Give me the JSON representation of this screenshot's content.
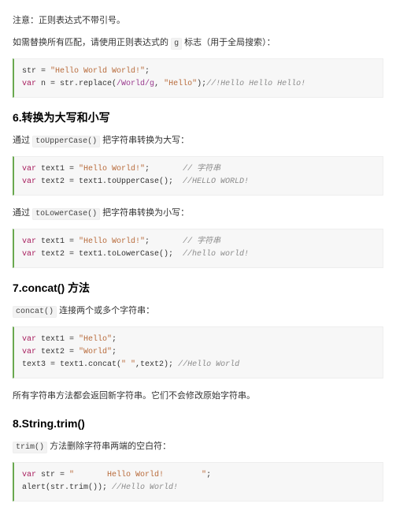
{
  "p1": "注意：正则表达式不带引号。",
  "p2_a": "如需替换所有匹配，请使用正则表达式的 ",
  "p2_code": "g",
  "p2_b": " 标志（用于全局搜索）：",
  "code1": {
    "l1_a": "str = ",
    "l1_b": "\"Hello World World!\"",
    "l1_c": ";",
    "l2_a": "var",
    "l2_b": " n = str.replace(",
    "l2_c": "/World/g",
    "l2_d": ", ",
    "l2_e": "\"Hello\"",
    "l2_f": ");",
    "l2_g": "//!Hello Hello Hello!"
  },
  "h6": "6.转换为大写和小写",
  "p3_a": "通过 ",
  "p3_code": "toUpperCase()",
  "p3_b": " 把字符串转换为大写：",
  "code2": {
    "l1_kw": "var",
    "l1_a": " text1 = ",
    "l1_s": "\"Hello World!\"",
    "l1_b": ";       ",
    "l1_cm": "// 字符串",
    "l2_kw": "var",
    "l2_a": " text2 = text1.toUpperCase();  ",
    "l2_cm": "//HELLO WORLD!"
  },
  "p4_a": "通过 ",
  "p4_code": "toLowerCase()",
  "p4_b": " 把字符串转换为小写：",
  "code3": {
    "l1_kw": "var",
    "l1_a": " text1 = ",
    "l1_s": "\"Hello World!\"",
    "l1_b": ";       ",
    "l1_cm": "// 字符串",
    "l2_kw": "var",
    "l2_a": " text2 = text1.toLowerCase();  ",
    "l2_cm": "//hello world!"
  },
  "h7": "7.concat() 方法",
  "p5_code": "concat()",
  "p5_a": " 连接两个或多个字符串：",
  "code4": {
    "l1_kw": "var",
    "l1_a": " text1 = ",
    "l1_s": "\"Hello\"",
    "l1_b": ";",
    "l2_kw": "var",
    "l2_a": " text2 = ",
    "l2_s": "\"World\"",
    "l2_b": ";",
    "l3_a": "text3 = text1.concat(",
    "l3_s": "\" \"",
    "l3_b": ",text2); ",
    "l3_cm": "//Hello World"
  },
  "p6": "所有字符串方法都会返回新字符串。它们不会修改原始字符串。",
  "h8": "8.String.trim()",
  "p7_code": "trim()",
  "p7_a": " 方法删除字符串两端的空白符：",
  "code5": {
    "l1_kw": "var",
    "l1_a": " str = ",
    "l1_s": "\"       Hello World!        \"",
    "l1_b": ";",
    "l2_a": "alert(str.trim()); ",
    "l2_cm": "//Hello World!"
  }
}
